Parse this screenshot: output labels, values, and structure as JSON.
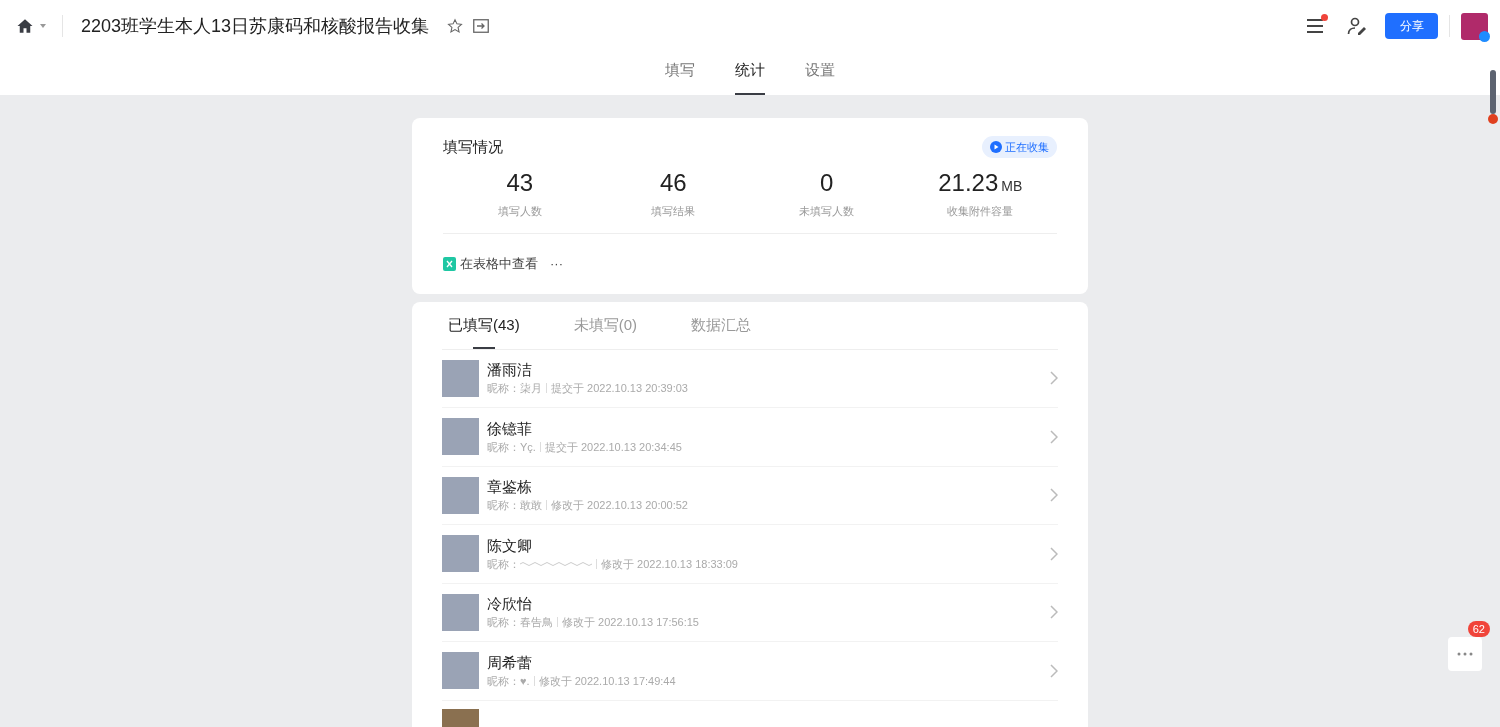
{
  "header": {
    "title": "2203班学生本人13日苏康码和核酸报告收集",
    "share_button": "分享",
    "notification_dot": true
  },
  "tabs": [
    {
      "label": "填写",
      "selected": false
    },
    {
      "label": "统计",
      "selected": true
    },
    {
      "label": "设置",
      "selected": false
    }
  ],
  "summary": {
    "title": "填写情况",
    "status": "正在收集",
    "stats": [
      {
        "value": "43",
        "label": "填写人数"
      },
      {
        "value": "46",
        "label": "填写结果"
      },
      {
        "value": "0",
        "label": "未填写人数"
      },
      {
        "value": "21.23",
        "unit": "MB",
        "label": "收集附件容量"
      }
    ],
    "view_link": "在表格中查看",
    "more": "···"
  },
  "list_tabs": [
    {
      "label": "已填写(43)",
      "selected": true
    },
    {
      "label": "未填写(0)",
      "selected": false
    },
    {
      "label": "数据汇总",
      "selected": false
    }
  ],
  "submissions": [
    {
      "name": "潘雨洁",
      "nickname_label": "昵称：",
      "nickname": "柒月",
      "time": "提交于 2022.10.13 20:39:03"
    },
    {
      "name": "徐镱菲",
      "nickname_label": "昵称：",
      "nickname": "Yç.",
      "time": "提交于 2022.10.13 20:34:45"
    },
    {
      "name": "章鉴栋",
      "nickname_label": "昵称：",
      "nickname": "敢敢",
      "time": "修改于 2022.10.13 20:00:52"
    },
    {
      "name": "陈文卿",
      "nickname_label": "昵称：",
      "time": "修改于 2022.10.13 18:33:09"
    },
    {
      "name": "冷欣怡",
      "nickname_label": "昵称：",
      "nickname": "春告鳥",
      "time": "修改于 2022.10.13 17:56:15"
    },
    {
      "name": "周希蕾",
      "nickname_label": "昵称：",
      "nickname": "♥.",
      "time": "修改于 2022.10.13 17:49:44"
    }
  ],
  "floating_badge": "62"
}
